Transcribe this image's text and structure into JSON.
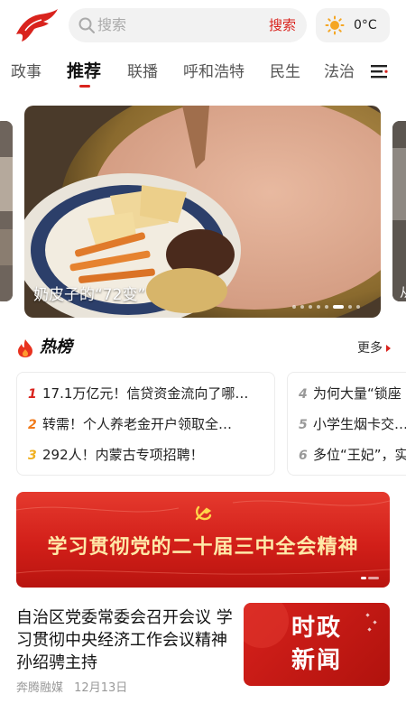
{
  "header": {
    "logo_icon": "red-horse-logo",
    "search": {
      "placeholder": "搜索",
      "button_label": "搜索"
    },
    "weather": {
      "icon": "sun-icon",
      "temperature": "0°C"
    }
  },
  "tabs": {
    "items": [
      {
        "label": "政事"
      },
      {
        "label": "推荐",
        "active": true
      },
      {
        "label": "联播"
      },
      {
        "label": "呼和浩特"
      },
      {
        "label": "民生"
      },
      {
        "label": "法治"
      }
    ],
    "menu_icon": "menu-icon"
  },
  "carousel": {
    "caption": "奶皮子的“72变”",
    "right_peek_text": "从",
    "slide_count": 8,
    "active_slide": 5
  },
  "hot_list": {
    "title": "热榜",
    "more_label": "更多",
    "left_items": [
      {
        "rank": "1",
        "text": "17.1万亿元！信贷资金流向了哪…"
      },
      {
        "rank": "2",
        "text": "转需！个人养老金开户领取全…"
      },
      {
        "rank": "3",
        "text": "292人！内蒙古专项招聘！"
      }
    ],
    "right_items": [
      {
        "rank": "4",
        "text": "为何大量“锁座"
      },
      {
        "rank": "5",
        "text": "小学生烟卡交…"
      },
      {
        "rank": "6",
        "text": "多位“王妃”，实"
      }
    ]
  },
  "banner": {
    "text": "学习贯彻党的二十届三中全会精神",
    "colors": {
      "background": "#d21f19",
      "text": "#ffe9a8"
    }
  },
  "news": {
    "title": "自治区党委常委会召开会议 学习贯彻中央经济工作会议精神 孙绍骋主持",
    "source": "奔腾融媒",
    "date": "12月13日",
    "thumbnail_lines": [
      "时政",
      "新闻"
    ]
  },
  "colors": {
    "accent": "#d9231d"
  }
}
